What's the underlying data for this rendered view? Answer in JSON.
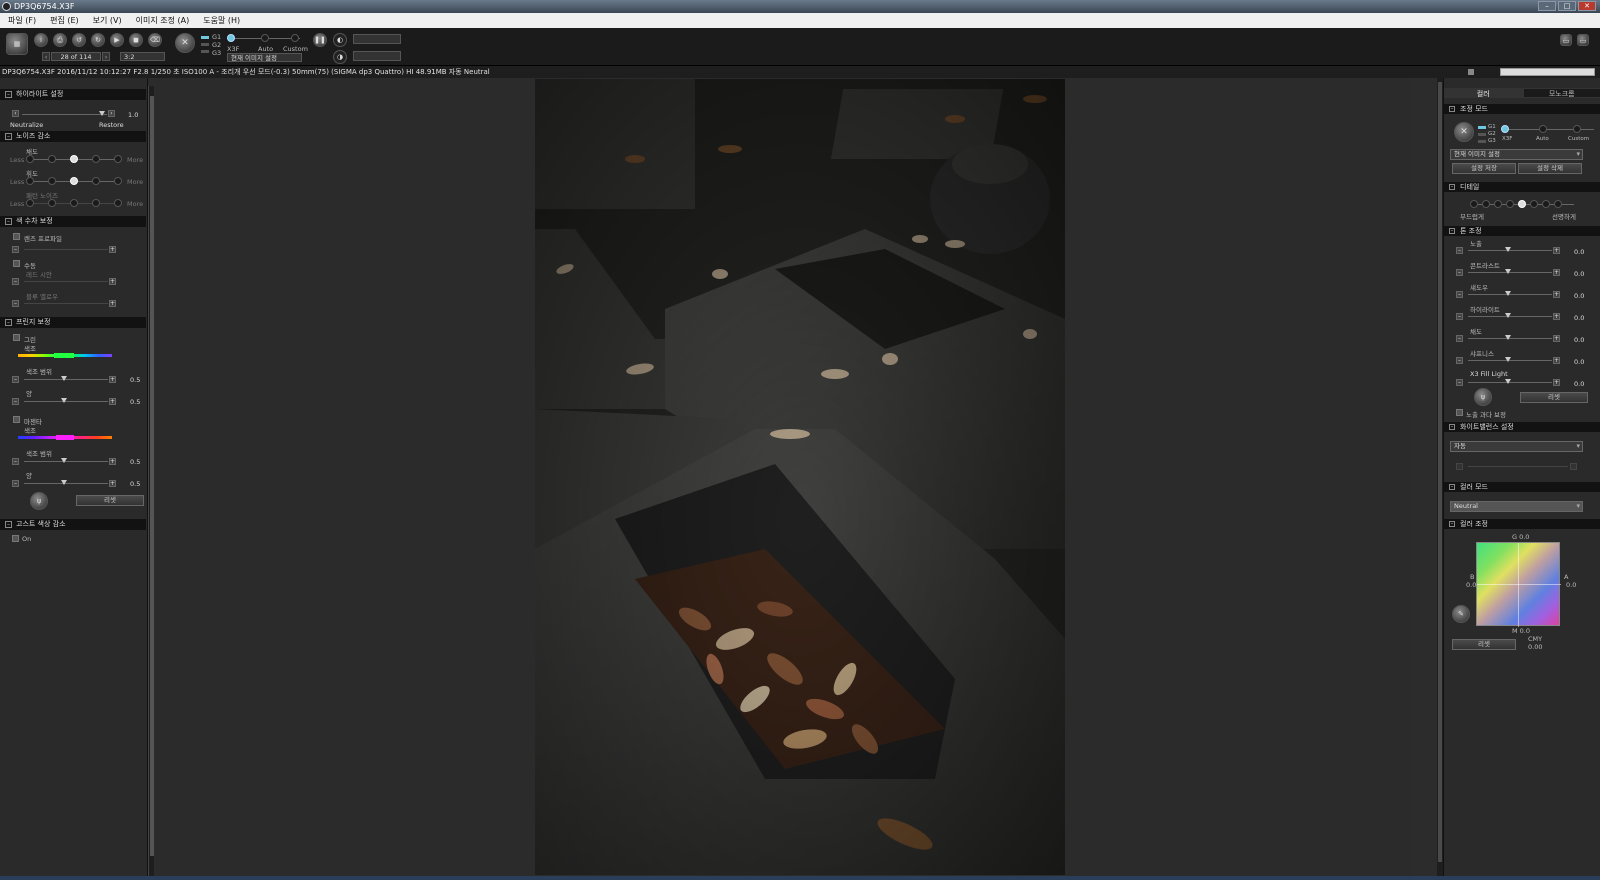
{
  "window": {
    "title": "DP3Q6754.X3F"
  },
  "menu": [
    "파일 (F)",
    "편집 (E)",
    "보기 (V)",
    "이미지 조정 (A)",
    "도움말 (H)"
  ],
  "toolbar": {
    "counter": "28 of 114",
    "ratio": "3:2",
    "mode_g1": "G1",
    "mode_g2": "G2",
    "mode_g3": "G3",
    "mode_x3f": "X3F",
    "mode_auto": "Auto",
    "mode_custom": "Custom",
    "preset": "현재 이미지 설정",
    "temp_a": "",
    "temp_b": ""
  },
  "info": "DP3Q6754.X3F 2016/11/12 10:12:27 F2.8 1/250 초 ISO100 A - 조리개 우선 모드(-0.3) 50mm(75) (SIGMA dp3 Quattro) HI 48.91MB 자동 Neutral",
  "left": {
    "highlight": {
      "title": "하이라이트 설정",
      "neutralize": "Neutralize",
      "restore": "Restore",
      "value": "1.0"
    },
    "noise": {
      "title": "노이즈 감소",
      "chroma": "채도",
      "luma": "휘도",
      "pattern": "패턴 노이즈",
      "less": "Less",
      "more": "More"
    },
    "aberration": {
      "title": "색 수차 보정",
      "lens_profile": "렌즈 프로파일",
      "manual": "수동",
      "red_cyan": "레드 시안",
      "blue_yellow": "블루 옐로우"
    },
    "fringe": {
      "title": "프린지 보정",
      "green": "그린",
      "magenta": "마젠타",
      "hue": "색조",
      "hue_range": "색조 범위",
      "amount": "양",
      "val1": "0.5",
      "val2": "0.5",
      "val3": "0.5",
      "val4": "0.5",
      "reset": "리셋"
    },
    "ghost": {
      "title": "고스트 색상 감소",
      "on": "On"
    }
  },
  "right": {
    "tab_color": "컬러",
    "tab_mono": "모노크롬",
    "mode": {
      "title": "조정 모드",
      "g1": "G1",
      "g2": "G2",
      "g3": "G3",
      "x3f": "X3F",
      "auto": "Auto",
      "custom": "Custom",
      "preset": "현재 이미지 설정",
      "save": "설정 저장",
      "delete": "설정 삭제"
    },
    "detail": {
      "title": "디테일",
      "soft": "부드럽게",
      "sharp": "선명하게"
    },
    "tone": {
      "title": "톤 조정",
      "exposure": "노출",
      "contrast": "콘트라스트",
      "shadow": "섀도우",
      "highlight": "하이라이트",
      "saturation": "채도",
      "sharpness": "샤프니스",
      "fill": "X3 Fill Light",
      "v": [
        "0.0",
        "0.0",
        "0.0",
        "0.0",
        "0.0",
        "0.0",
        "0.0"
      ],
      "reset": "리셋",
      "exposure_warn": "노출 과다 보정"
    },
    "wb": {
      "title": "화이트밸런스 설정",
      "value": "자동"
    },
    "colormode": {
      "title": "컬러 모드",
      "value": "Neutral"
    },
    "coloradj": {
      "title": "컬러 조정",
      "g": "G 0.0",
      "m": "M 0.0",
      "b": "B",
      "a": "A",
      "b_val": "0.0",
      "a_val": "0.0",
      "cmy": "CMY",
      "cmy_val": "0.00",
      "reset": "리셋"
    }
  },
  "colors": {
    "accent": "#6fc8e0",
    "panel": "#2a2a2a",
    "header": "#121212"
  }
}
